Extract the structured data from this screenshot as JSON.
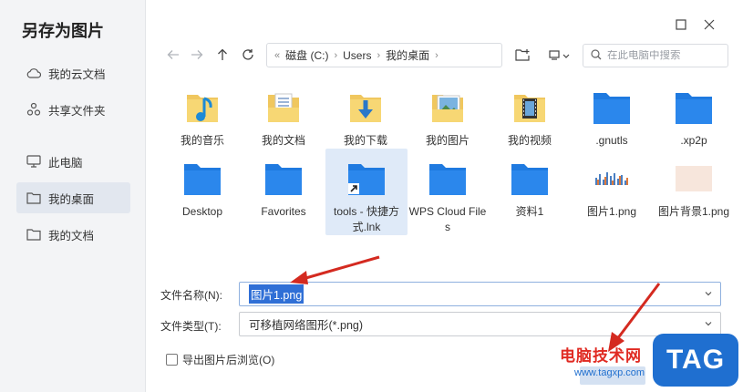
{
  "dialog": {
    "title": "另存为图片"
  },
  "sidebar": {
    "items": [
      {
        "label": "我的云文档",
        "icon": "cloud-icon"
      },
      {
        "label": "共享文件夹",
        "icon": "share-icon"
      },
      {
        "label": "此电脑",
        "icon": "monitor-icon"
      },
      {
        "label": "我的桌面",
        "icon": "folder-icon",
        "active": true
      },
      {
        "label": "我的文档",
        "icon": "folder-icon"
      }
    ]
  },
  "breadcrumb": {
    "items": [
      "磁盘 (C:)",
      "Users",
      "我的桌面"
    ]
  },
  "search": {
    "placeholder": "在此电脑中搜索"
  },
  "files": [
    {
      "name": "我的音乐",
      "icon": "music-folder-icon"
    },
    {
      "name": "我的文档",
      "icon": "documents-folder-icon"
    },
    {
      "name": "我的下载",
      "icon": "downloads-folder-icon"
    },
    {
      "name": "我的图片",
      "icon": "pictures-folder-icon"
    },
    {
      "name": "我的视频",
      "icon": "videos-folder-icon"
    },
    {
      "name": ".gnutls",
      "icon": "folder-icon"
    },
    {
      "name": ".xp2p",
      "icon": "folder-icon"
    },
    {
      "name": "Desktop",
      "icon": "folder-icon"
    },
    {
      "name": "Favorites",
      "icon": "folder-icon"
    },
    {
      "name": "tools - 快捷方式.lnk",
      "icon": "shortcut-folder-icon",
      "selected": true
    },
    {
      "name": "WPS Cloud Files",
      "icon": "folder-icon"
    },
    {
      "name": "资料1",
      "icon": "folder-icon"
    },
    {
      "name": "图片1.png",
      "icon": "image-thumbnail-icon"
    },
    {
      "name": "图片背景1.png",
      "icon": "image-thumbnail-icon"
    }
  ],
  "form": {
    "filename_label": "文件名称(N):",
    "filename_value": "图片1.png",
    "filetype_label": "文件类型(T):",
    "filetype_value": "可移植网络图形(*.png)",
    "browse_after_export_label": "导出图片后浏览(O)",
    "browse_after_export_checked": false
  },
  "watermark": {
    "site_name": "电脑技术网",
    "url": "www.tagxp.com",
    "logo_text": "TAG"
  },
  "colors": {
    "accent": "#2f6fd6",
    "folder_blue": "#1f7ae0",
    "annotation_red": "#d42a20"
  }
}
